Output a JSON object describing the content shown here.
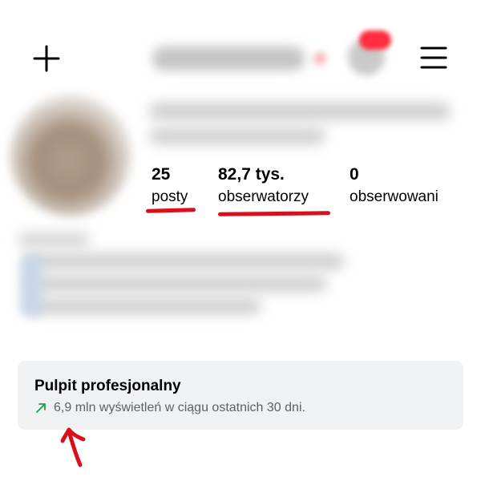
{
  "header": {
    "add_icon": "plus-icon",
    "menu_icon": "hamburger-menu-icon",
    "notification_color": "#ff2d3f"
  },
  "stats": {
    "posts": {
      "value": "25",
      "label": "posty"
    },
    "followers": {
      "value": "82,7 tys.",
      "label": "obserwatorzy"
    },
    "following": {
      "value": "0",
      "label": "obserwowani"
    }
  },
  "dashboard": {
    "title": "Pulpit profesjonalny",
    "subtitle": "6,9 mln wyświetleń w ciągu ostatnich 30 dni.",
    "trend_icon": "trending-up-arrow-icon",
    "trend_color": "#1f9e4a"
  },
  "annotations": {
    "underline_color": "#d8101c",
    "arrow_icon": "hand-drawn-arrow-icon"
  }
}
